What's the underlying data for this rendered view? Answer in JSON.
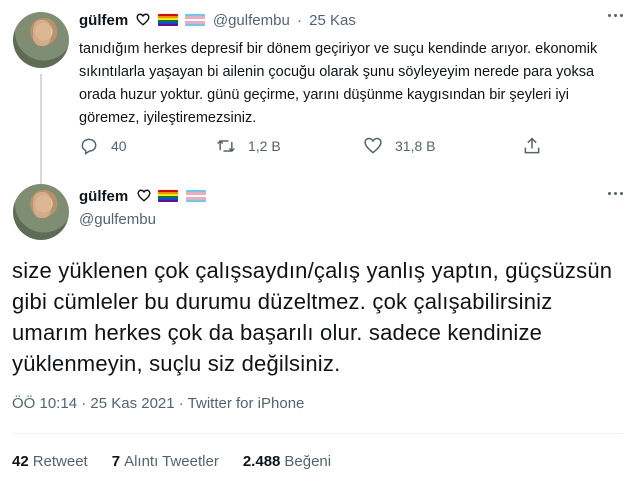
{
  "tweet1": {
    "display_name": "gülfem",
    "handle": "@gulfembu",
    "separator": "·",
    "date": "25 Kas",
    "text": "tanıdığım herkes depresif bir dönem geçiriyor ve suçu kendinde arıyor. ekonomik sıkıntılarla yaşayan bi ailenin çocuğu olarak şunu söyleyeyim nerede para yoksa orada huzur yoktur. günü geçirme, yarını düşünme kaygısından bir şeyleri iyi göremez, iyileştiremezsiniz.",
    "actions": {
      "reply_count": "40",
      "retweet_count": "1,2 B",
      "like_count": "31,8 B"
    }
  },
  "tweet2": {
    "display_name": "gülfem",
    "handle": "@gulfembu",
    "text": "size yüklenen çok çalışsaydın/çalış yanlış yaptın, güçsüzsün gibi cümleler bu durumu düzeltmez. çok çalışabilirsiniz umarım herkes çok da başarılı olur. sadece kendinize yüklenmeyin, suçlu siz değilsiniz.",
    "meta": "ÖÖ 10:14 · 25 Kas 2021 · Twitter for iPhone",
    "stats": {
      "retweets_value": "42",
      "retweets_label": "Retweet",
      "quotes_value": "7",
      "quotes_label": "Alıntı Tweetler",
      "likes_value": "2.488",
      "likes_label": "Beğeni"
    }
  },
  "icons": {
    "more": "more-icon",
    "heart": "white-heart-icon",
    "rainbow_flag": "rainbow-flag-icon",
    "trans_flag": "transgender-flag-icon",
    "reply": "reply-icon",
    "retweet": "retweet-icon",
    "like": "like-icon",
    "share": "share-icon"
  },
  "colors": {
    "text": "#0f1419",
    "muted": "#536471",
    "divider": "#eff3f4"
  }
}
